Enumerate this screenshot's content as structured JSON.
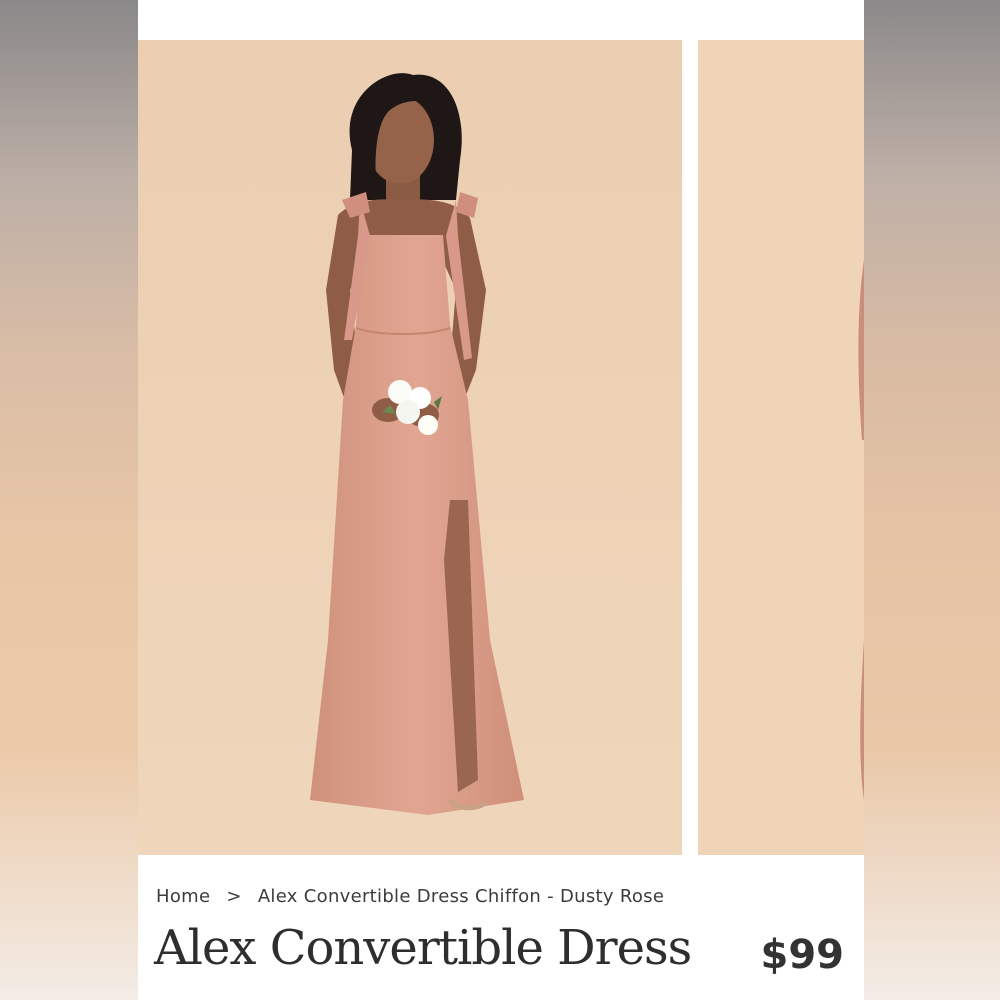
{
  "breadcrumb": {
    "home": "Home",
    "separator": ">",
    "current": "Alex Convertible Dress Chiffon - Dusty Rose"
  },
  "product": {
    "title": "Alex Convertible Dress",
    "price": "$99"
  },
  "colors": {
    "backdrop": "#efd2b3",
    "dress": "#dca08c",
    "text": "#2e2e2e"
  },
  "gallery": {
    "main_image": "model-in-dusty-rose-dress",
    "next_image": "partial-next-product-photo"
  }
}
